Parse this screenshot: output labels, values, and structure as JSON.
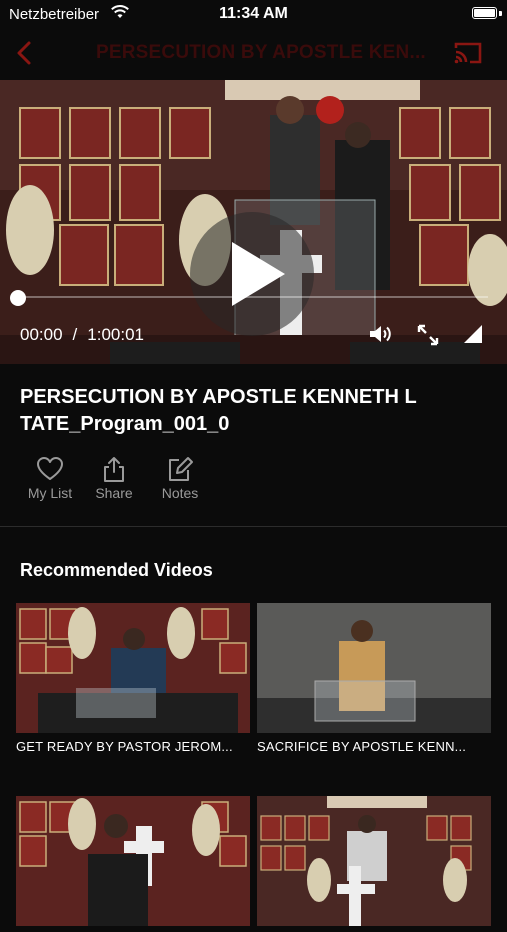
{
  "status_bar": {
    "carrier": "Netzbetreiber",
    "time": "11:34 AM"
  },
  "nav": {
    "title": "PERSECUTION BY APOSTLE KEN...",
    "back_icon": "chevron-left-icon",
    "cast_icon": "cast-icon"
  },
  "player": {
    "current_time": "00:00",
    "separator": "/",
    "duration": "1:00:01",
    "progress": 0
  },
  "video": {
    "title": "PERSECUTION BY APOSTLE KENNETH L TATE_Program_001_0"
  },
  "actions": [
    {
      "label": "My List",
      "icon": "heart-icon"
    },
    {
      "label": "Share",
      "icon": "share-icon"
    },
    {
      "label": "Notes",
      "icon": "edit-icon"
    }
  ],
  "recommended": {
    "heading": "Recommended Videos",
    "items": [
      {
        "caption": "GET READY BY PASTOR JEROM..."
      },
      {
        "caption": "SACRIFICE BY APOSTLE KENN..."
      },
      {
        "caption": ""
      },
      {
        "caption": ""
      }
    ]
  },
  "colors": {
    "accent": "#c0201b",
    "title_dim": "#3a0b0b",
    "background": "#0b0b0b"
  }
}
